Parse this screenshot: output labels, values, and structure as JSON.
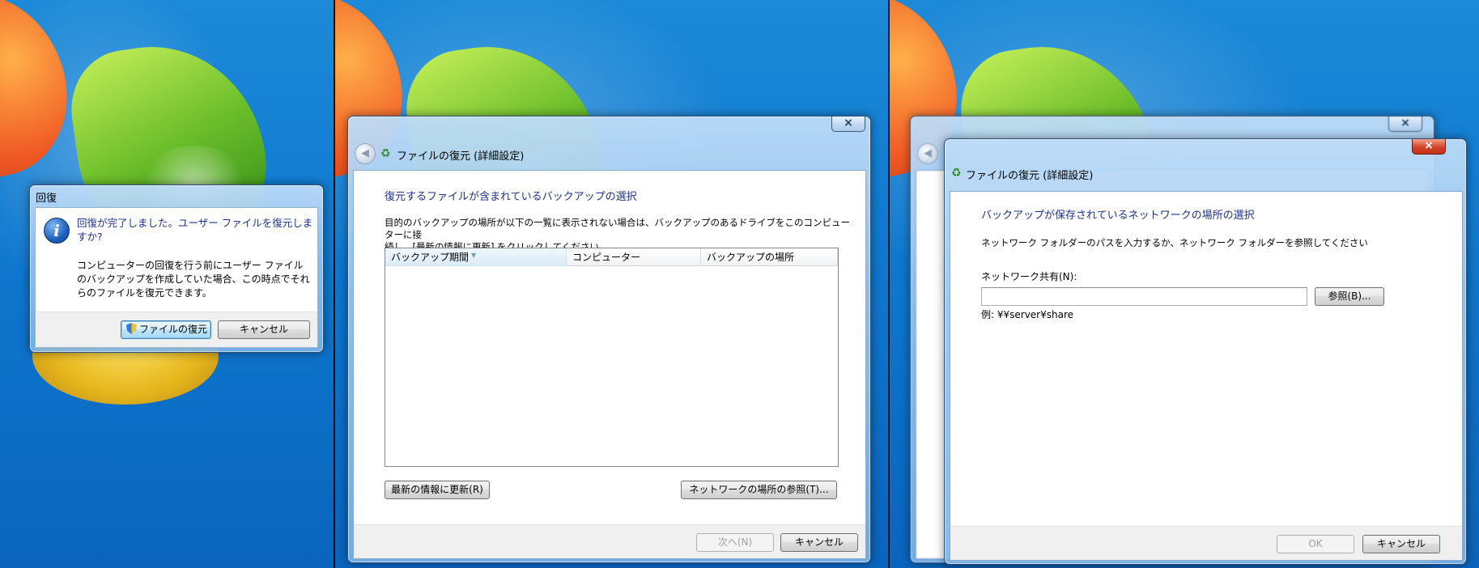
{
  "recovery_dialog": {
    "title": "回復",
    "icon": "info-icon",
    "message_line1": "回復が完了しました。ユーザー ファイルを復元しま",
    "message_line2": "すか?",
    "detail_line1": "コンピューターの回復を行う前にユーザー ファイル",
    "detail_line2": "のバックアップを作成していた場合、この時点でそれ",
    "detail_line3": "らのファイルを復元できます。",
    "restore_button": "ファイルの復元",
    "cancel_button": "キャンセル"
  },
  "advanced_wizard": {
    "close_symbol": "×",
    "title": "ファイルの復元 (詳細設定)",
    "heading": "復元するファイルが含まれているバックアップの選択",
    "description_line1": "目的のバックアップの場所が以下の一覧に表示されない場合は、バックアップのあるドライブをこのコンピューターに接",
    "description_line2": "続し、[最新の情報に更新] をクリックしてください。",
    "columns": [
      "バックアップ期間",
      "コンピューター",
      "バックアップの場所"
    ],
    "rows": [],
    "refresh_button": "最新の情報に更新(R)",
    "browse_network_button": "ネットワークの場所の参照(T)...",
    "next_button": "次へ(N)",
    "cancel_button": "キャンセル"
  },
  "network_dialog": {
    "close_symbol": "×",
    "title": "ファイルの復元 (詳細設定)",
    "heading": "バックアップが保存されているネットワークの場所の選択",
    "description": "ネットワーク フォルダーのパスを入力するか、ネットワーク フォルダーを参照してください",
    "share_label": "ネットワーク共有(N):",
    "share_value": "",
    "browse_button": "参照(B)...",
    "example": "例: ¥¥server¥share",
    "ok_button": "OK",
    "cancel_button": "キャンセル"
  }
}
